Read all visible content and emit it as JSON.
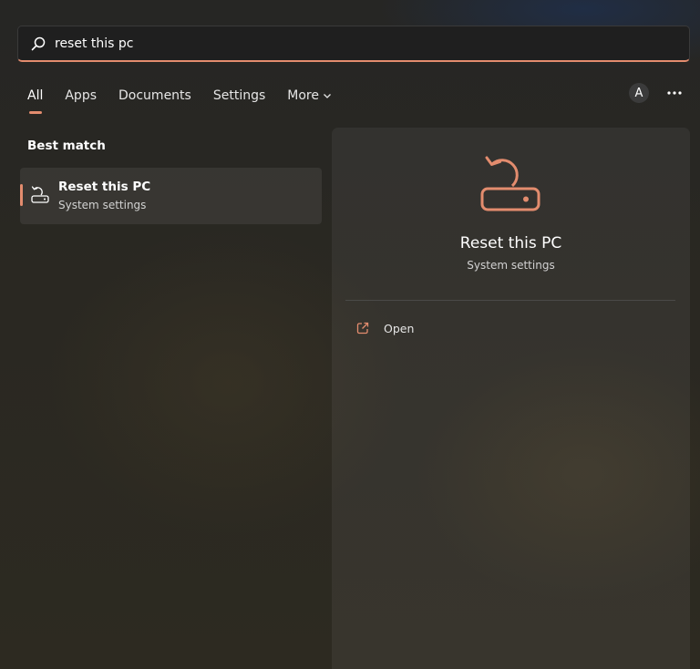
{
  "search": {
    "value": "reset this pc",
    "icon": "search-icon"
  },
  "tabs": [
    {
      "label": "All",
      "active": true
    },
    {
      "label": "Apps",
      "active": false
    },
    {
      "label": "Documents",
      "active": false
    },
    {
      "label": "Settings",
      "active": false
    },
    {
      "label": "More",
      "active": false
    }
  ],
  "header": {
    "account_initial": "A",
    "options_icon": "ellipsis-icon"
  },
  "best_match": {
    "heading": "Best match",
    "item": {
      "title": "Reset this PC",
      "subtitle": "System settings",
      "icon": "reset-pc-icon"
    }
  },
  "details": {
    "title": "Reset this PC",
    "subtitle": "System settings",
    "icon": "reset-pc-icon",
    "actions": [
      {
        "label": "Open",
        "icon": "open-external-icon"
      }
    ]
  },
  "colors": {
    "accent": "#e38c6e",
    "background": "#2b2922",
    "panel": "#333330"
  }
}
